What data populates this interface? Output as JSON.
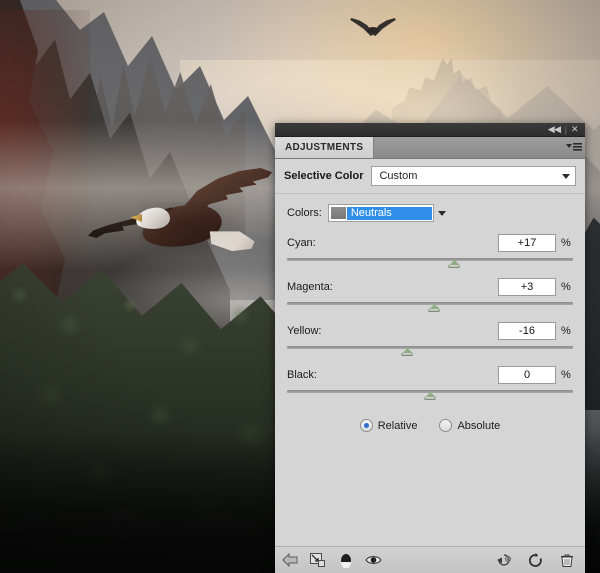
{
  "window": {
    "collapse_label": "◀◀",
    "separator": "|",
    "close_label": "✕"
  },
  "panel": {
    "tab_label": "ADJUSTMENTS",
    "menu_icon": "panel-menu-icon",
    "preset": {
      "title": "Selective Color",
      "selected": "Custom"
    },
    "colors": {
      "label": "Colors:",
      "selected": "Neutrals"
    },
    "sliders": [
      {
        "name": "Cyan:",
        "value": "+17",
        "unit": "%",
        "pos": 58.5
      },
      {
        "name": "Magenta:",
        "value": "+3",
        "unit": "%",
        "pos": 51.5
      },
      {
        "name": "Yellow:",
        "value": "-16",
        "unit": "%",
        "pos": 42.0
      },
      {
        "name": "Black:",
        "value": "0",
        "unit": "%",
        "pos": 50.0
      }
    ],
    "mode": {
      "relative_label": "Relative",
      "absolute_label": "Absolute",
      "selected": "Relative"
    },
    "footer": {
      "left_icons": [
        {
          "name": "return-to-adjustment-list-icon",
          "glyph": "◀"
        },
        {
          "name": "clip-to-layer-icon",
          "glyph": "⬓"
        },
        {
          "name": "toggle-layer-mask-icon",
          "glyph": "◑"
        },
        {
          "name": "toggle-layer-visibility-icon",
          "glyph": "◉"
        }
      ],
      "right_icons": [
        {
          "name": "view-previous-state-icon",
          "glyph": "◔"
        },
        {
          "name": "reset-adjustment-icon",
          "glyph": "↻"
        },
        {
          "name": "delete-adjustment-layer-icon",
          "glyph": "🗑"
        }
      ]
    }
  },
  "colors": {
    "panel_bg": "#d5d5d5",
    "tab_bar": "#9d9d9d",
    "titlebar": "#2e2e2e",
    "selection_blue": "#2f8fe8",
    "radio_blue": "#2f6fd0",
    "slider_thumb": "#8fae84"
  },
  "photo": {
    "description": "Misty mountain valley at sunrise with a bald eagle in flight, a distant castle on a ridge, and a small soaring bird near the top"
  }
}
